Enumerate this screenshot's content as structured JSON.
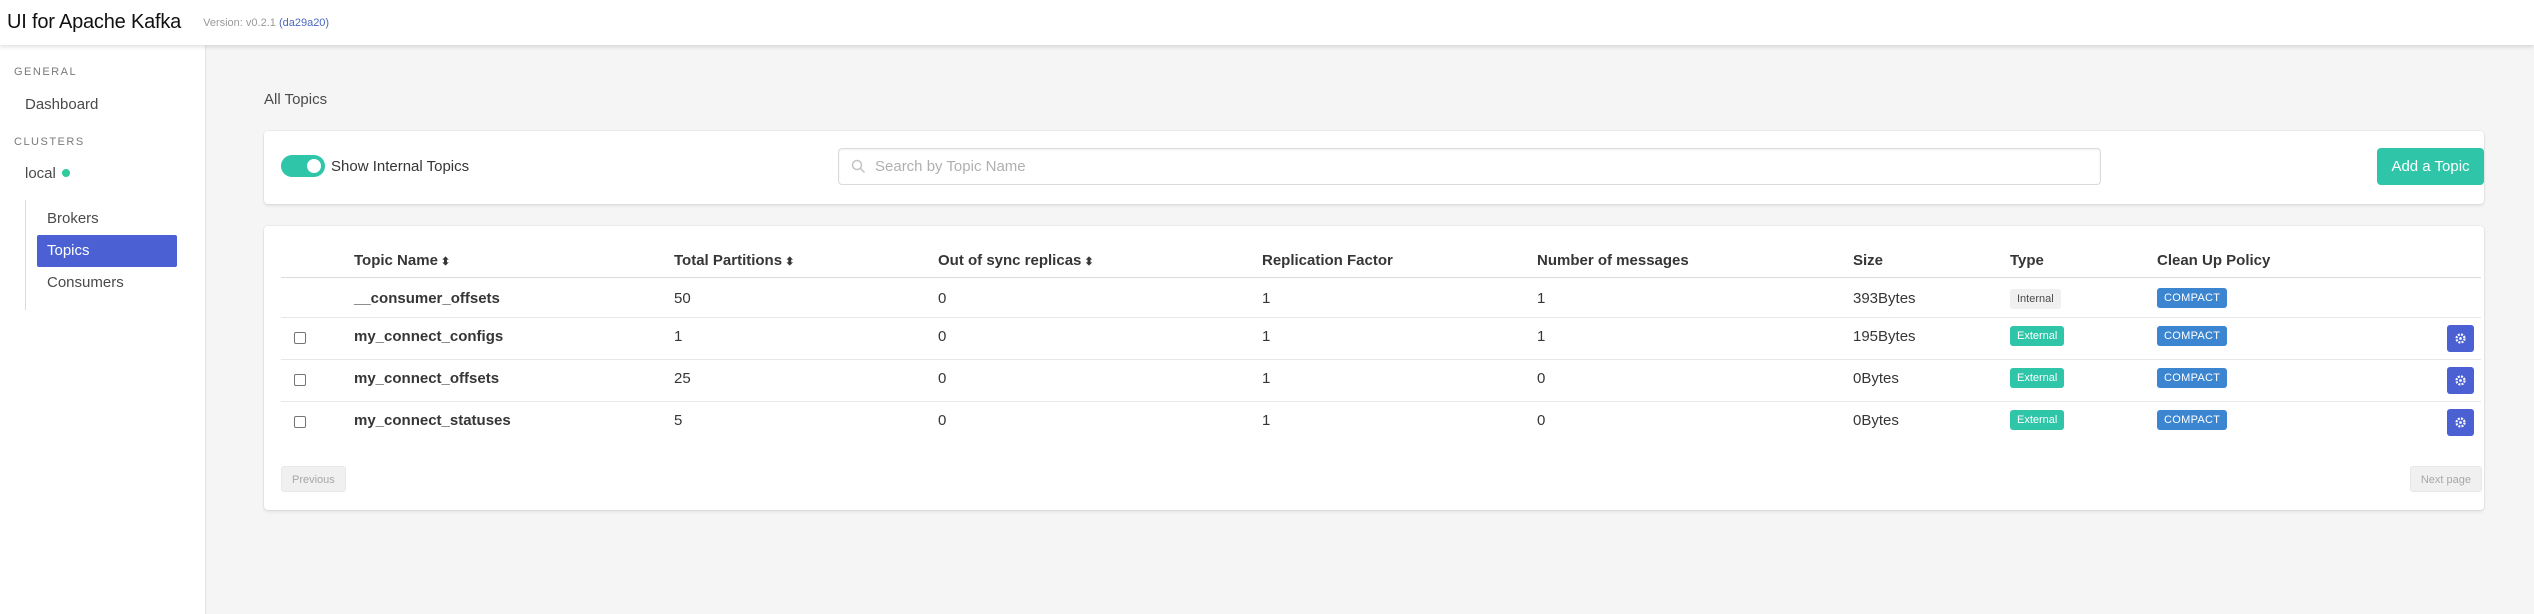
{
  "header": {
    "title": "UI for Apache Kafka",
    "version_label": "Version:",
    "version_number": "v0.2.1",
    "version_hash": "(da29a20)"
  },
  "sidebar": {
    "general_label": "GENERAL",
    "dashboard": "Dashboard",
    "clusters_label": "CLUSTERS",
    "cluster_name": "local",
    "cluster_status_color": "#2fcb9c",
    "items": [
      {
        "label": "Brokers"
      },
      {
        "label": "Topics",
        "active": true
      },
      {
        "label": "Consumers"
      }
    ]
  },
  "main": {
    "title": "All Topics",
    "toggle_label": "Show Internal Topics",
    "toggle_on": true,
    "search_placeholder": "Search by Topic Name",
    "add_button": "Add a Topic",
    "columns": [
      "Topic Name",
      "Total Partitions",
      "Out of sync replicas",
      "Replication Factor",
      "Number of messages",
      "Size",
      "Type",
      "Clean Up Policy"
    ],
    "rows": [
      {
        "name": "__consumer_offsets",
        "partitions": "50",
        "out_of_sync": "0",
        "replication": "1",
        "messages": "1",
        "size": "393Bytes",
        "type": "Internal",
        "policy": "COMPACT"
      },
      {
        "name": "my_connect_configs",
        "partitions": "1",
        "out_of_sync": "0",
        "replication": "1",
        "messages": "1",
        "size": "195Bytes",
        "type": "External",
        "policy": "COMPACT"
      },
      {
        "name": "my_connect_offsets",
        "partitions": "25",
        "out_of_sync": "0",
        "replication": "1",
        "messages": "0",
        "size": "0Bytes",
        "type": "External",
        "policy": "COMPACT"
      },
      {
        "name": "my_connect_statuses",
        "partitions": "5",
        "out_of_sync": "0",
        "replication": "1",
        "messages": "0",
        "size": "0Bytes",
        "type": "External",
        "policy": "COMPACT"
      }
    ],
    "prev_button": "Previous",
    "next_button": "Next page"
  },
  "colors": {
    "accent_green": "#2ec5a8",
    "accent_blue": "#4a60d3",
    "policy_blue": "#3b85d1"
  }
}
